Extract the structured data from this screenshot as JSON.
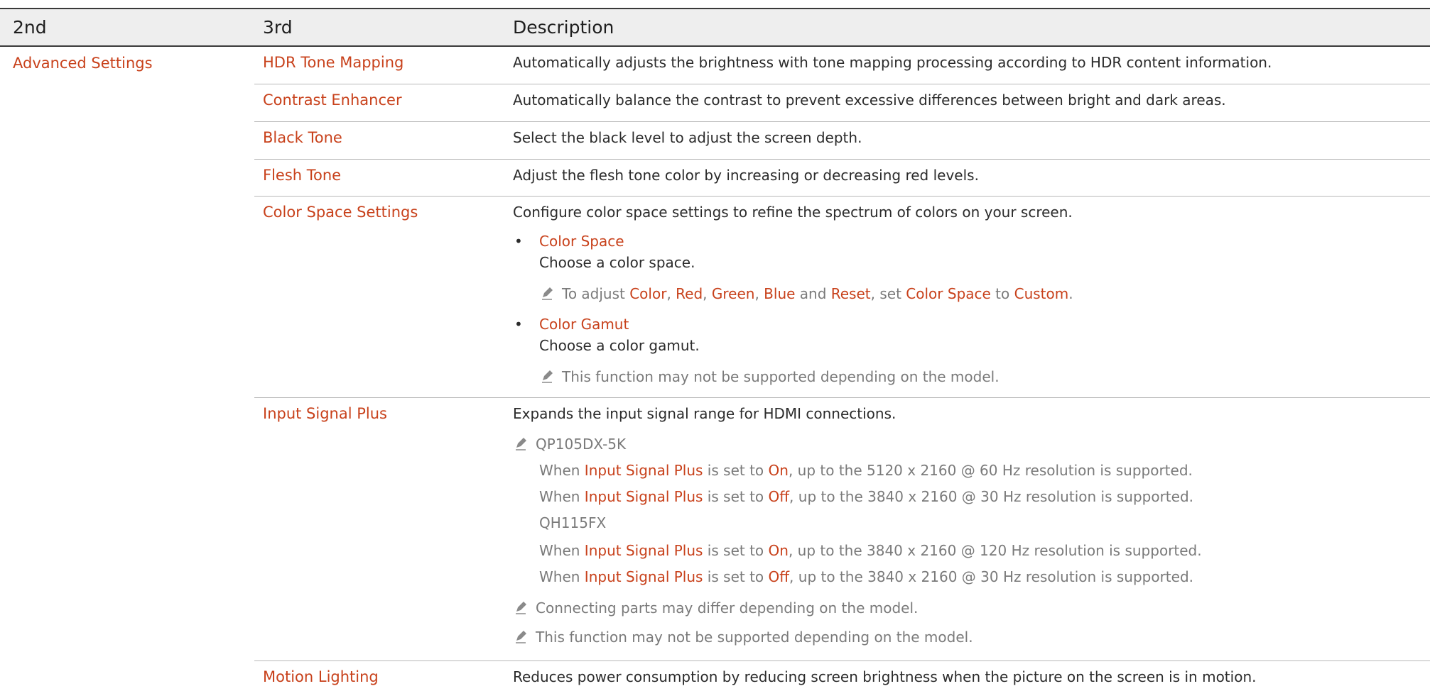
{
  "header": {
    "col_2nd": "2nd",
    "col_3rd": "3rd",
    "col_desc": "Description"
  },
  "group": {
    "label": "Advanced Settings"
  },
  "rows": {
    "hdr_tone": {
      "label": "HDR Tone Mapping",
      "desc": "Automatically adjusts the brightness with tone mapping processing according to HDR content information."
    },
    "contrast": {
      "label": "Contrast Enhancer",
      "desc": "Automatically balance the contrast to prevent excessive differences between bright and dark areas."
    },
    "black_tone": {
      "label": "Black Tone",
      "desc": "Select the black level to adjust the screen depth."
    },
    "flesh_tone": {
      "label": "Flesh Tone",
      "desc": "Adjust the flesh tone color by increasing or decreasing red levels."
    },
    "color_space": {
      "label": "Color Space Settings",
      "desc": "Configure color space settings to refine the spectrum of colors on your screen.",
      "bullet1": {
        "title": "Color Space",
        "text": "Choose a color space."
      },
      "note1": {
        "p1": "To adjust ",
        "color": "Color",
        "c1": ", ",
        "red": "Red",
        "c2": ", ",
        "green": "Green",
        "c3": ", ",
        "blue": "Blue",
        "and": " and ",
        "reset": "Reset",
        "set": ", set ",
        "space": "Color Space",
        "to": " to ",
        "custom": "Custom",
        "end": "."
      },
      "bullet2": {
        "title": "Color Gamut",
        "text": "Choose a color gamut."
      },
      "note2": "This function may not be supported depending on the model."
    },
    "input_signal": {
      "label": "Input Signal Plus",
      "desc": "Expands the input signal range for HDMI connections.",
      "model1": "QP105DX-5K",
      "l1": {
        "pre": "When ",
        "name": "Input Signal Plus",
        "mid": " is set to ",
        "state": "On",
        "post": ", up to the 5120 x 2160 @ 60 Hz resolution is supported."
      },
      "l2": {
        "pre": "When ",
        "name": "Input Signal Plus",
        "mid": " is set to ",
        "state": "Off",
        "post": ", up to the 3840 x 2160 @ 30 Hz resolution is supported."
      },
      "model2": "QH115FX",
      "l3": {
        "pre": "When ",
        "name": "Input Signal Plus",
        "mid": " is set to ",
        "state": "On",
        "post": ", up to the 3840 x 2160 @ 120 Hz resolution is supported."
      },
      "l4": {
        "pre": "When ",
        "name": "Input Signal Plus",
        "mid": " is set to ",
        "state": "Off",
        "post": ", up to the 3840 x 2160 @ 30 Hz resolution is supported."
      },
      "note_a": "Connecting parts may differ depending on the model.",
      "note_b": "This function may not be supported depending on the model."
    },
    "motion": {
      "label": "Motion Lighting",
      "desc": "Reduces power consumption by reducing screen brightness when the picture on the screen is in motion."
    }
  },
  "colors": {
    "accent": "#c8411b",
    "text": "#2b2b2b",
    "note": "#7a7a7a",
    "header_bg": "#eeeeee"
  },
  "icons": {
    "note": "pencil-icon",
    "bullet": "bullet"
  }
}
